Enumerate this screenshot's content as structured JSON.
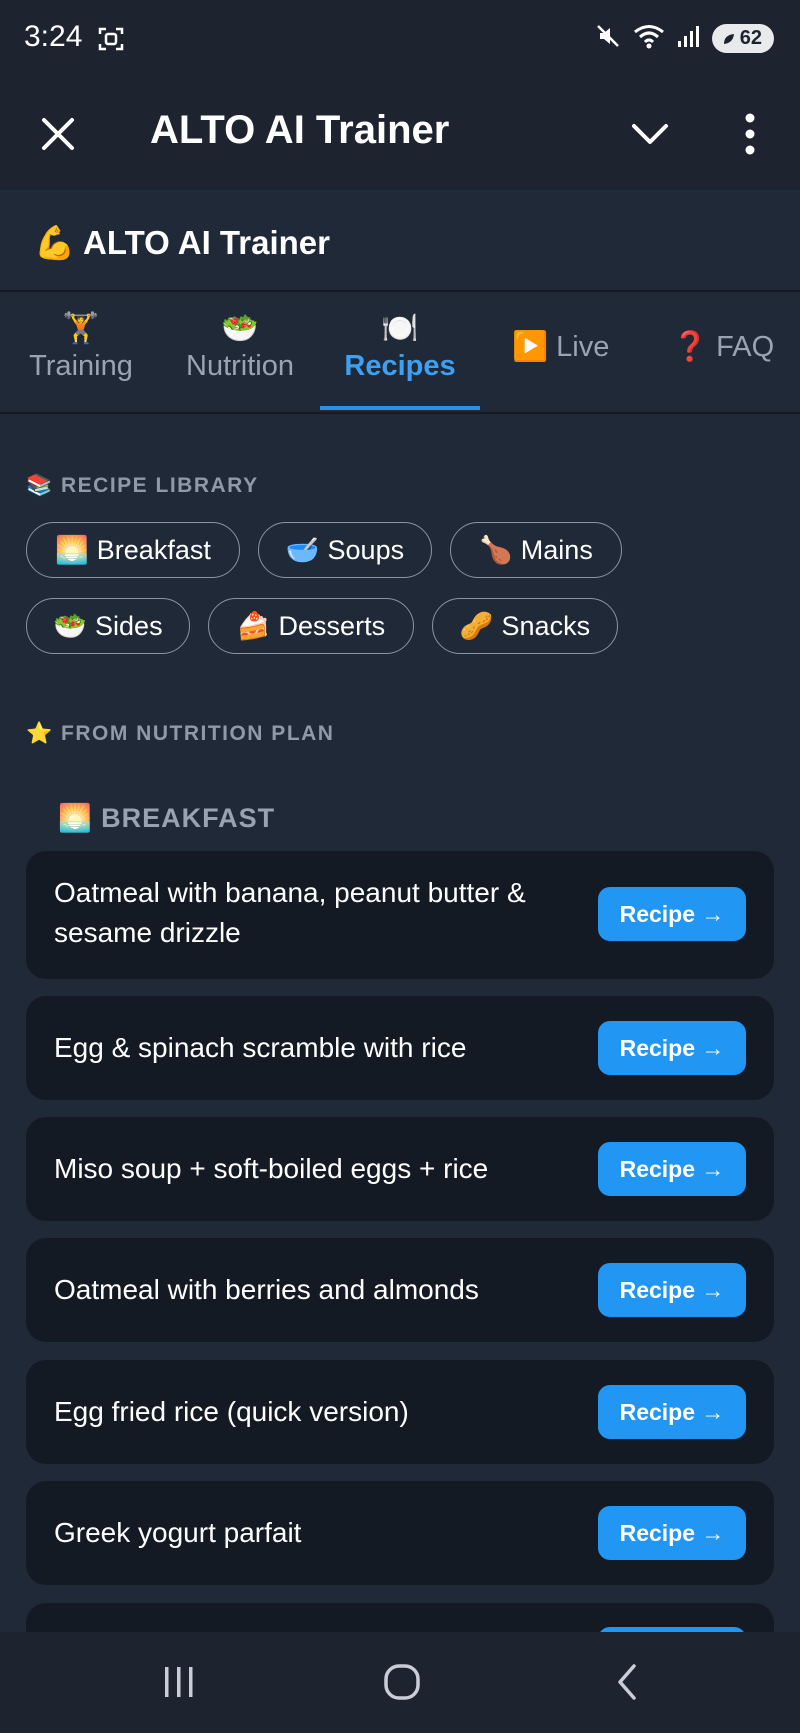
{
  "status_bar": {
    "time": "3:24",
    "battery": "62",
    "icons": [
      "screenshot-icon",
      "mute-icon",
      "wifi-icon",
      "signal-icon",
      "battery-icon"
    ]
  },
  "app_bar": {
    "title": "ALTO AI Trainer",
    "icons": [
      "close-icon",
      "chevron-down-icon",
      "more-vert-icon"
    ]
  },
  "page_header": {
    "emoji": "💪",
    "title": "ALTO AI Trainer"
  },
  "tabs": [
    {
      "emoji": "🏋️",
      "label": "Training"
    },
    {
      "emoji": "🥗",
      "label": "Nutrition"
    },
    {
      "emoji": "🍽️",
      "label": "Recipes",
      "active": true
    },
    {
      "emoji": "▶️",
      "label": "Live"
    },
    {
      "emoji": "❓",
      "label": "FAQ"
    }
  ],
  "recipe_library": {
    "emoji": "📚",
    "label": "RECIPE LIBRARY",
    "chips": [
      {
        "emoji": "🌅",
        "label": "Breakfast"
      },
      {
        "emoji": "🥣",
        "label": "Soups"
      },
      {
        "emoji": "🍗",
        "label": "Mains"
      },
      {
        "emoji": "🥗",
        "label": "Sides"
      },
      {
        "emoji": "🍰",
        "label": "Desserts"
      },
      {
        "emoji": "🥜",
        "label": "Snacks"
      }
    ]
  },
  "nutrition_plan": {
    "emoji": "⭐",
    "label": "FROM NUTRITION PLAN",
    "group": {
      "emoji": "🌅",
      "label": "BREAKFAST"
    },
    "recipes": [
      {
        "title": "Oatmeal with banana, peanut butter & sesame drizzle",
        "button": "Recipe →"
      },
      {
        "title": "Egg & spinach scramble with rice",
        "button": "Recipe →"
      },
      {
        "title": "Miso soup + soft-boiled eggs + rice",
        "button": "Recipe →"
      },
      {
        "title": "Oatmeal with berries and almonds",
        "button": "Recipe →"
      },
      {
        "title": "Egg fried rice (quick version)",
        "button": "Recipe →"
      },
      {
        "title": "Greek yogurt parfait",
        "button": "Recipe →"
      }
    ]
  },
  "nav_bar": {
    "icons": [
      "recent-apps-icon",
      "home-icon",
      "back-icon"
    ]
  },
  "colors": {
    "background": "#202938",
    "card": "#141a24",
    "accent": "#2196f3",
    "active_tab": "#3da0f0",
    "muted_text": "#9aa3b1"
  }
}
